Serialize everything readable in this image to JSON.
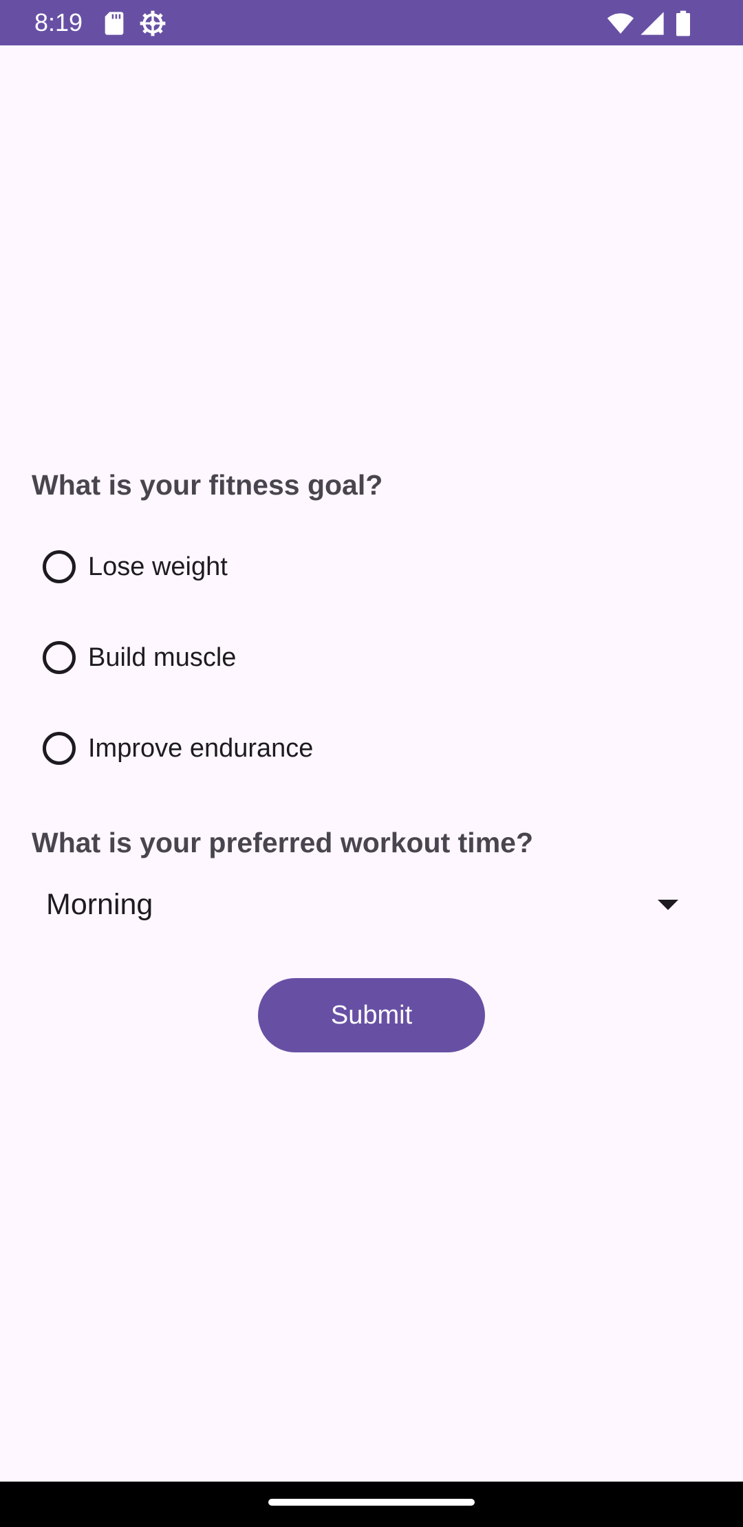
{
  "status_bar": {
    "time": "8:19",
    "background_color": "#6750A4",
    "icons": [
      "sd-card-icon",
      "settings-gear-icon",
      "wifi-icon",
      "cell-signal-icon",
      "battery-icon"
    ]
  },
  "form": {
    "fitness_goal_question": "What is your fitness goal?",
    "fitness_goal_options": [
      {
        "label": "Lose weight",
        "selected": false
      },
      {
        "label": "Build muscle",
        "selected": false
      },
      {
        "label": "Improve endurance",
        "selected": false
      }
    ],
    "workout_time_question": "What is your preferred workout time?",
    "workout_time_selected": "Morning",
    "submit_label": "Submit"
  },
  "colors": {
    "primary": "#6750A4",
    "background": "#FEF7FF",
    "on_surface": "#1D1B20",
    "on_surface_variant": "#49454F"
  }
}
